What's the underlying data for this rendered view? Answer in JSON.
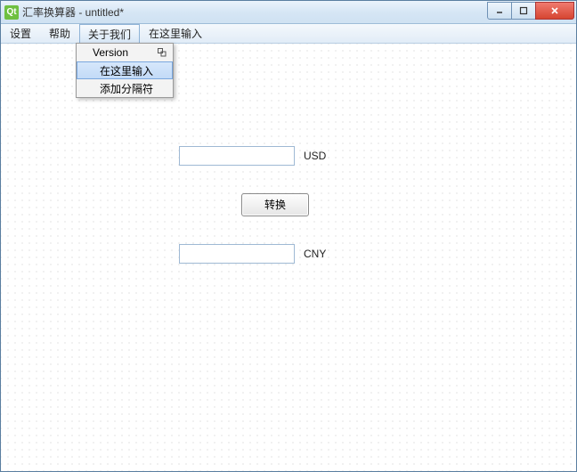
{
  "window": {
    "title": "汇率换算器 - untitled*",
    "icon_text": "Qt"
  },
  "menubar": {
    "items": [
      {
        "label": "设置"
      },
      {
        "label": "帮助"
      },
      {
        "label": "关于我们"
      },
      {
        "label": "在这里输入"
      }
    ],
    "active_index": 2
  },
  "dropdown": {
    "items": [
      {
        "label": "Version",
        "has_submenu_icon": true
      },
      {
        "label": "在这里输入"
      },
      {
        "label": "添加分隔符"
      }
    ],
    "selected_index": 1
  },
  "form": {
    "input_value": "",
    "input_currency": "USD",
    "output_value": "",
    "output_currency": "CNY",
    "convert_label": "转换"
  }
}
